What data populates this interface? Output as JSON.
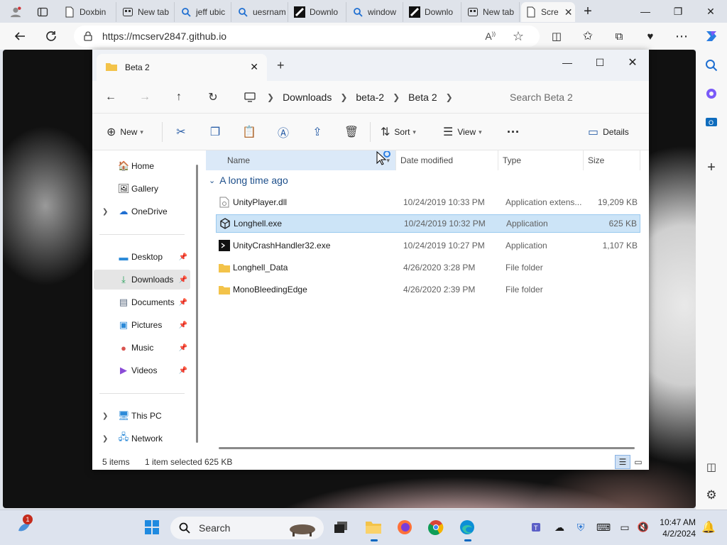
{
  "browser": {
    "tabs": [
      {
        "label": "Doxbin",
        "icon": "page-icon"
      },
      {
        "label": "New tab",
        "icon": "newtab-icon"
      },
      {
        "label": "jeff ubic",
        "icon": "search-icon"
      },
      {
        "label": "uesrnam",
        "icon": "search-icon"
      },
      {
        "label": "Downlo",
        "icon": "download-site-icon"
      },
      {
        "label": "window",
        "icon": "search-icon"
      },
      {
        "label": "Downlo",
        "icon": "download-site-icon"
      },
      {
        "label": "New tab",
        "icon": "newtab-icon"
      },
      {
        "label": "Scre",
        "icon": "page-icon"
      }
    ],
    "url": "https://mcserv2847.github.io"
  },
  "explorer": {
    "tab_title": "Beta 2",
    "breadcrumb": [
      "Downloads",
      "beta-2",
      "Beta 2"
    ],
    "search_placeholder": "Search Beta 2",
    "toolbar": {
      "new_label": "New",
      "sort_label": "Sort",
      "view_label": "View",
      "details_label": "Details"
    },
    "nav_pane": {
      "home": "Home",
      "gallery": "Gallery",
      "onedrive": "OneDrive",
      "desktop": "Desktop",
      "downloads": "Downloads",
      "documents": "Documents",
      "pictures": "Pictures",
      "music": "Music",
      "videos": "Videos",
      "this_pc": "This PC",
      "network": "Network"
    },
    "columns": {
      "name": "Name",
      "date": "Date modified",
      "type": "Type",
      "size": "Size"
    },
    "group_label": "A long time ago",
    "files": [
      {
        "name": "UnityPlayer.dll",
        "date": "10/24/2019 10:33 PM",
        "type": "Application extens...",
        "size": "19,209 KB",
        "icon": "dll-icon"
      },
      {
        "name": "Longhell.exe",
        "date": "10/24/2019 10:32 PM",
        "type": "Application",
        "size": "625 KB",
        "icon": "unity-icon"
      },
      {
        "name": "UnityCrashHandler32.exe",
        "date": "10/24/2019 10:27 PM",
        "type": "Application",
        "size": "1,107 KB",
        "icon": "crash-handler-icon"
      },
      {
        "name": "Longhell_Data",
        "date": "4/26/2020 3:28 PM",
        "type": "File folder",
        "size": "",
        "icon": "folder-icon"
      },
      {
        "name": "MonoBleedingEdge",
        "date": "4/26/2020 2:39 PM",
        "type": "File folder",
        "size": "",
        "icon": "folder-icon"
      }
    ],
    "status": {
      "items": "5 items",
      "selected": "1 item selected",
      "size": "625 KB"
    }
  },
  "taskbar": {
    "search_label": "Search",
    "notification_count": "1",
    "time": "10:47 AM",
    "date": "4/2/2024"
  },
  "colors": {
    "selection": "#cce4f7",
    "accent": "#0067c0",
    "folder": "#f3c34a"
  }
}
